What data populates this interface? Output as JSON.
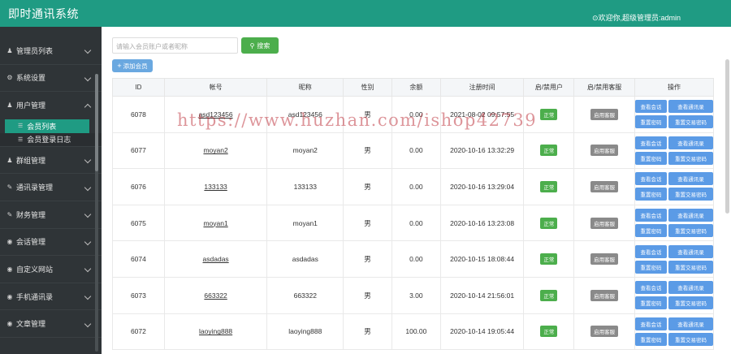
{
  "header": {
    "app_title": "即时通讯系统",
    "welcome": "⊙欢迎你,超级管理员:admin"
  },
  "sidebar": {
    "items": [
      {
        "label": "管理员列表",
        "icon": "person-icon"
      },
      {
        "label": "系统设置",
        "icon": "gear-icon"
      },
      {
        "label": "用户管理",
        "icon": "person-icon",
        "expanded": true,
        "children": [
          {
            "label": "会员列表",
            "active": true
          },
          {
            "label": "会员登录日志",
            "active": false
          }
        ]
      },
      {
        "label": "群组管理",
        "icon": "group-icon"
      },
      {
        "label": "通讯录管理",
        "icon": "edit-icon"
      },
      {
        "label": "财务管理",
        "icon": "edit-icon"
      },
      {
        "label": "会话管理",
        "icon": "chat-icon"
      },
      {
        "label": "自定义网站",
        "icon": "globe-icon"
      },
      {
        "label": "手机通讯录",
        "icon": "phone-icon"
      },
      {
        "label": "文章管理",
        "icon": "doc-icon"
      }
    ]
  },
  "toolbar": {
    "search_placeholder": "请输入会员账户或者昵称",
    "search_label": "搜索",
    "add_label": "添加会员"
  },
  "table": {
    "columns": [
      "ID",
      "帐号",
      "昵称",
      "性别",
      "余额",
      "注册时间",
      "启/禁用户",
      "启/禁用客服",
      "操作"
    ],
    "rows": [
      {
        "id": "6078",
        "account": "asd123456",
        "nickname": "asd123456",
        "gender": "男",
        "balance": "0.00",
        "reg_time": "2021-08-02 09:57:55",
        "user_status": "正常",
        "service_status": "启用客服"
      },
      {
        "id": "6077",
        "account": "moyan2",
        "nickname": "moyan2",
        "gender": "男",
        "balance": "0.00",
        "reg_time": "2020-10-16 13:32:29",
        "user_status": "正常",
        "service_status": "启用客服"
      },
      {
        "id": "6076",
        "account": "133133",
        "nickname": "133133",
        "gender": "男",
        "balance": "0.00",
        "reg_time": "2020-10-16 13:29:04",
        "user_status": "正常",
        "service_status": "启用客服"
      },
      {
        "id": "6075",
        "account": "moyan1",
        "nickname": "moyan1",
        "gender": "男",
        "balance": "0.00",
        "reg_time": "2020-10-16 13:23:08",
        "user_status": "正常",
        "service_status": "启用客服"
      },
      {
        "id": "6074",
        "account": "asdadas",
        "nickname": "asdadas",
        "gender": "男",
        "balance": "0.00",
        "reg_time": "2020-10-15 18:08:44",
        "user_status": "正常",
        "service_status": "启用客服"
      },
      {
        "id": "6073",
        "account": "663322",
        "nickname": "663322",
        "gender": "男",
        "balance": "3.00",
        "reg_time": "2020-10-14 21:56:01",
        "user_status": "正常",
        "service_status": "启用客服"
      },
      {
        "id": "6072",
        "account": "laoying888",
        "nickname": "laoying888",
        "gender": "男",
        "balance": "100.00",
        "reg_time": "2020-10-14 19:05:44",
        "user_status": "正常",
        "service_status": "启用客服"
      }
    ],
    "actions": [
      "查看会话",
      "查看通讯录",
      "重置密码",
      "重置交易密码"
    ]
  },
  "watermark": "https://www.huzhan.com/ishop42739",
  "colors": {
    "brand": "#1f9b83",
    "sidebar_bg": "#2f3437",
    "success": "#4cae4c",
    "action_blue": "#5b9be6",
    "neutral_badge": "#8a8a8a"
  }
}
